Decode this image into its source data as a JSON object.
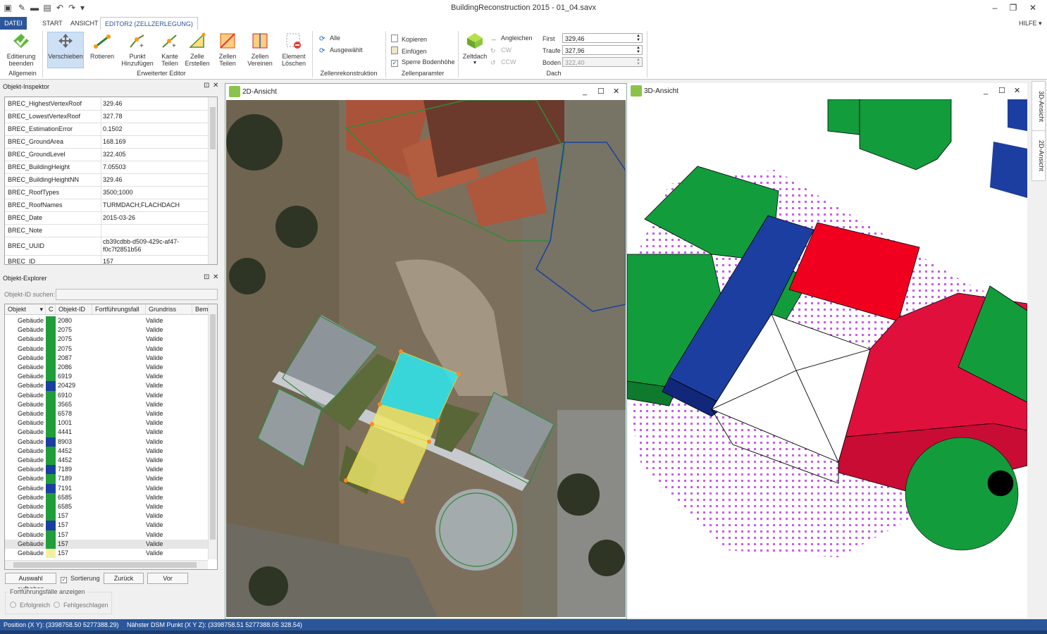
{
  "app": {
    "title": "BuildingReconstruction 2015 - 01_04.savx",
    "help": "HILFE"
  },
  "tabs": [
    "DATEI",
    "START",
    "ANSICHT",
    "EDITOR2 (ZELLZERLEGUNG)"
  ],
  "ribbon": {
    "buttons": {
      "end_edit": "Editierung beenden",
      "move": "Verschieben",
      "rotate": "Rotieren",
      "add_point": "Punkt Hinzufügen",
      "split_edge": "Kante Teilen",
      "create_cell": "Zelle Erstellen",
      "split_cell": "Zellen Teilen",
      "merge_cells": "Zellen Vereinen",
      "delete_element": "Element Löschen",
      "all": "Alle",
      "selected": "Ausgewählt",
      "copy": "Kopieren",
      "paste": "Einfügen",
      "lock_ground": "Sperre Bodenhöhe",
      "tent_roof": "Zeltdach",
      "align": "Angleichen",
      "cw": "CW",
      "ccw": "CCW"
    },
    "groups": {
      "general": "Allgemein",
      "advanced_editor": "Erweiterter Editor",
      "cell_reconstruction": "Zellenrekonstruktion",
      "cell_params": "Zellenparamter",
      "roof": "Dach"
    },
    "fields": {
      "first_label": "First",
      "first_value": "329,46",
      "eave_label": "Traufe",
      "eave_value": "327,96",
      "ground_label": "Boden",
      "ground_value": "322,40"
    }
  },
  "inspector": {
    "title": "Objekt-Inspektor",
    "rows": [
      {
        "k": "BREC_HighestVertexRoof",
        "v": "329.46"
      },
      {
        "k": "BREC_LowestVertexRoof",
        "v": "327.78"
      },
      {
        "k": "BREC_EstimationError",
        "v": "0.1502"
      },
      {
        "k": "BREC_GroundArea",
        "v": "168.169"
      },
      {
        "k": "BREC_GroundLevel",
        "v": "322.405"
      },
      {
        "k": "BREC_BuildingHeight",
        "v": "7.05503"
      },
      {
        "k": "BREC_BuildingHeightNN",
        "v": "329.46"
      },
      {
        "k": "BREC_RoofTypes",
        "v": "3500;1000"
      },
      {
        "k": "BREC_RoofNames",
        "v": "TURMDACH;FLACHDACH"
      },
      {
        "k": "BREC_Date",
        "v": "2015-03-26"
      },
      {
        "k": "BREC_Note",
        "v": ""
      },
      {
        "k": "BREC_UUID",
        "v": "cb39cdbb-d509-429c-af47-f0c7f2851b56"
      },
      {
        "k": "BREC_ID",
        "v": "157"
      }
    ]
  },
  "explorer": {
    "title": "Objekt-Explorer",
    "search_label": "Objekt-ID suchen:",
    "columns": [
      "Objekt",
      "C",
      "Objekt-ID",
      "Fortführungsfall",
      "Grundriss",
      "Beme"
    ],
    "rows": [
      {
        "obj": "Gebäude",
        "c": "#1f9e3a",
        "id": "2080",
        "g": "Valide"
      },
      {
        "obj": "Gebäude",
        "c": "#1f9e3a",
        "id": "2075",
        "g": "Valide"
      },
      {
        "obj": "Gebäude",
        "c": "#1f9e3a",
        "id": "2075",
        "g": "Valide"
      },
      {
        "obj": "Gebäude",
        "c": "#1f9e3a",
        "id": "2075",
        "g": "Valide"
      },
      {
        "obj": "Gebäude",
        "c": "#1f9e3a",
        "id": "2087",
        "g": "Valide"
      },
      {
        "obj": "Gebäude",
        "c": "#1f9e3a",
        "id": "2086",
        "g": "Valide"
      },
      {
        "obj": "Gebäude",
        "c": "#1f9e3a",
        "id": "6919",
        "g": "Valide"
      },
      {
        "obj": "Gebäude",
        "c": "#1c3ea0",
        "id": "20429",
        "g": "Valide"
      },
      {
        "obj": "Gebäude",
        "c": "#1f9e3a",
        "id": "6910",
        "g": "Valide"
      },
      {
        "obj": "Gebäude",
        "c": "#1f9e3a",
        "id": "3565",
        "g": "Valide"
      },
      {
        "obj": "Gebäude",
        "c": "#1f9e3a",
        "id": "6578",
        "g": "Valide"
      },
      {
        "obj": "Gebäude",
        "c": "#1f9e3a",
        "id": "1001",
        "g": "Valide"
      },
      {
        "obj": "Gebäude",
        "c": "#1f9e3a",
        "id": "4441",
        "g": "Valide"
      },
      {
        "obj": "Gebäude",
        "c": "#1c3ea0",
        "id": "8903",
        "g": "Valide"
      },
      {
        "obj": "Gebäude",
        "c": "#1f9e3a",
        "id": "4452",
        "g": "Valide"
      },
      {
        "obj": "Gebäude",
        "c": "#1f9e3a",
        "id": "4452",
        "g": "Valide"
      },
      {
        "obj": "Gebäude",
        "c": "#1c3ea0",
        "id": "7189",
        "g": "Valide"
      },
      {
        "obj": "Gebäude",
        "c": "#1f9e3a",
        "id": "7189",
        "g": "Valide"
      },
      {
        "obj": "Gebäude",
        "c": "#1c3ea0",
        "id": "7191",
        "g": "Valide"
      },
      {
        "obj": "Gebäude",
        "c": "#1f9e3a",
        "id": "6585",
        "g": "Valide"
      },
      {
        "obj": "Gebäude",
        "c": "#1f9e3a",
        "id": "6585",
        "g": "Valide"
      },
      {
        "obj": "Gebäude",
        "c": "#1f9e3a",
        "id": "157",
        "g": "Valide"
      },
      {
        "obj": "Gebäude",
        "c": "#1c3ea0",
        "id": "157",
        "g": "Valide"
      },
      {
        "obj": "Gebäude",
        "c": "#1f9e3a",
        "id": "157",
        "g": "Valide"
      },
      {
        "obj": "Gebäude",
        "c": "#1f9e3a",
        "id": "157",
        "g": "Valide"
      },
      {
        "obj": "Gebäude",
        "c": "#f4f0a0",
        "id": "157",
        "g": "Valide"
      }
    ],
    "buttons": {
      "clear_selection": "Auswahl aufheben",
      "sort": "Sortierung",
      "back": "Zurück",
      "forward": "Vor"
    },
    "filter_group": "Fortführungsfälle anzeigen",
    "filter_success": "Erfolgreich",
    "filter_failed": "Fehlgeschlagen"
  },
  "views": {
    "view2d": "2D-Ansicht",
    "view3d": "3D-Ansicht",
    "side_tab1": "3D-Ansicht",
    "side_tab2": "2D-Ansicht"
  },
  "status": {
    "position": "Position (X Y): (3398758.50  5277388.29)",
    "dsm": "Nähster DSM Punkt (X Y Z): (3398758.51  5277388.05  328.54)"
  },
  "colors": {
    "accent": "#2b579a",
    "green_roof": "#0f9a3a",
    "blue_roof": "#1c3ea0",
    "red_roof": "#f0001e",
    "cyan_cell": "#2ee8ee",
    "yellow_cell": "#eee86a",
    "point_cloud": "#c85af0"
  }
}
